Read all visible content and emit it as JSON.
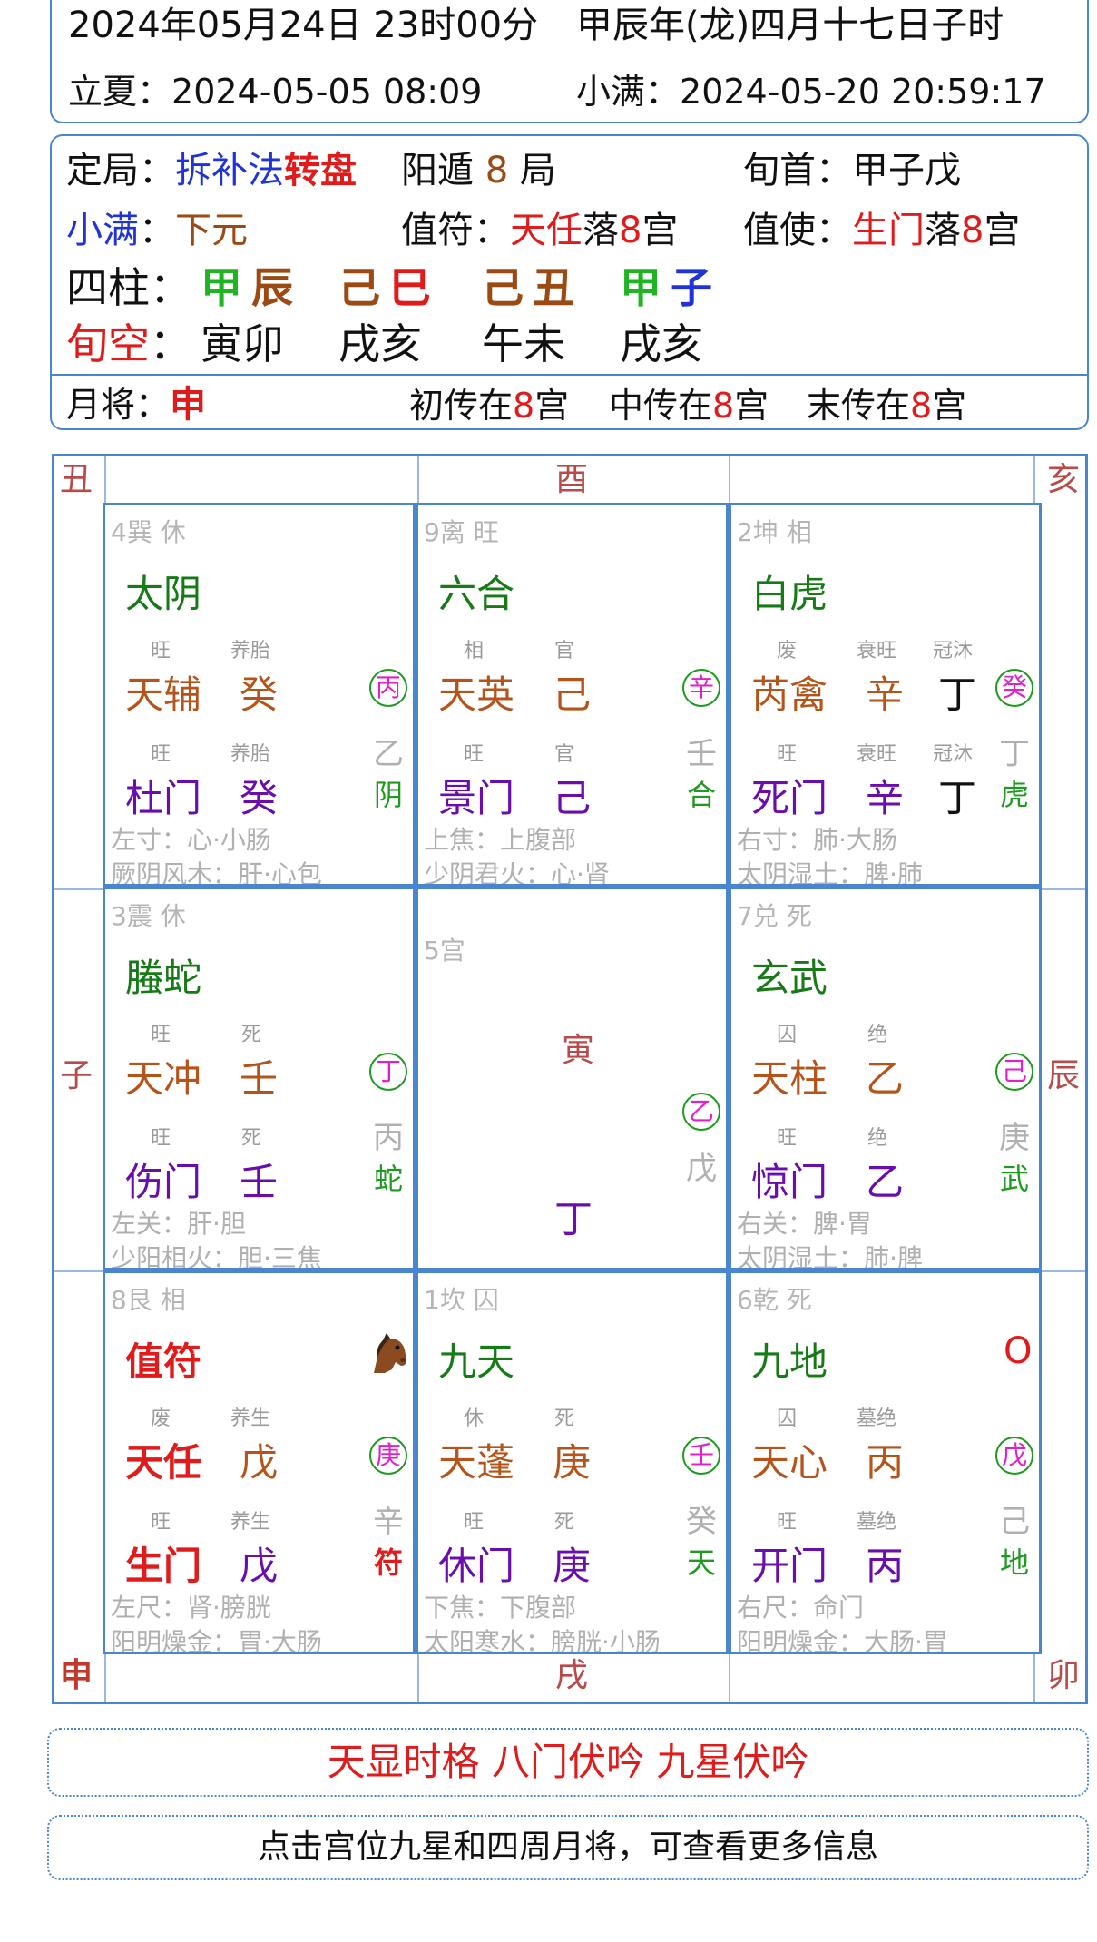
{
  "header": {
    "solar_datetime": "2024年05月24日 23时00分",
    "lunar_datetime": "甲辰年(龙)四月十七日子时",
    "term1_label": "立夏",
    "term1_value": "2024-05-05 08:09",
    "term2_label": "小满",
    "term2_value": "2024-05-20 20:59:17"
  },
  "info": {
    "dingju_label": "定局",
    "method_a": "拆补法",
    "method_b": "转盘",
    "dun": "阳遁",
    "ju_num": "8",
    "ju": "局",
    "xunshou_label": "旬首",
    "xunshou_value": "甲子戊",
    "term_label": "小满",
    "yuan": "下元",
    "zhifu_label": "值符",
    "zhifu_star": "天任",
    "zhifu_luo": "落",
    "zhifu_num": "8",
    "zhifu_gong": "宫",
    "zhishi_label": "值使",
    "zhishi_door": "生门",
    "zhishi_luo": "落",
    "zhishi_num": "8",
    "zhishi_gong": "宫",
    "sizhu_label": "四柱",
    "pillars": [
      {
        "stem": "甲",
        "branch": "辰"
      },
      {
        "stem": "己",
        "branch": "巳"
      },
      {
        "stem": "己",
        "branch": "丑"
      },
      {
        "stem": "甲",
        "branch": "子"
      }
    ],
    "xunkong_label": "旬空",
    "xunkong": [
      "寅卯",
      "戌亥",
      "午未",
      "戌亥"
    ],
    "yuejiang_label": "月将",
    "yuejiang_value": "申",
    "chu": {
      "pre": "初传在",
      "num": "8",
      "suf": "宫"
    },
    "zhong": {
      "pre": "中传在",
      "num": "8",
      "suf": "宫"
    },
    "mo": {
      "pre": "末传在",
      "num": "8",
      "suf": "宫"
    }
  },
  "board": {
    "corners": {
      "tl": "丑",
      "tc": "酉",
      "tr": "亥",
      "ml": "子",
      "mr": "辰",
      "bl": "申",
      "bc": "戌",
      "br": "卯"
    },
    "palaces": [
      {
        "head": "4巽  休",
        "god": "太阴",
        "star_lbl1": "旺",
        "star_lbl2": "养胎",
        "star": "天辅",
        "star_stem": "癸",
        "star_stem2": "",
        "circle": "丙",
        "gstem": "乙",
        "door_lbl1": "旺",
        "door_lbl2": "养胎",
        "door": "杜门",
        "door_stem": "癸",
        "door_stem2": "",
        "abbr": "阴",
        "foot1": "左寸：心·小肠",
        "foot2": "厥阴风木：肝·心包"
      },
      {
        "head": "9离  旺",
        "god": "六合",
        "star_lbl1": "相",
        "star_lbl2": "官",
        "star": "天英",
        "star_stem": "己",
        "star_stem2": "",
        "circle": "辛",
        "gstem": "壬",
        "door_lbl1": "旺",
        "door_lbl2": "官",
        "door": "景门",
        "door_stem": "己",
        "door_stem2": "",
        "abbr": "合",
        "foot1": "上焦：上腹部",
        "foot2": "少阴君火：心·肾"
      },
      {
        "head": "2坤  相",
        "god": "白虎",
        "star_lbl1": "废",
        "star_lbl2": "衰旺",
        "star_lbl3": "冠沐",
        "star": "芮禽",
        "star_stem": "辛",
        "star_stem2": "丁",
        "circle": "癸",
        "gstem": "丁",
        "door_lbl1": "旺",
        "door_lbl2": "衰旺",
        "door_lbl3": "冠沐",
        "door": "死门",
        "door_stem": "辛",
        "door_stem2": "丁",
        "abbr": "虎",
        "foot1": "右寸：肺·大肠",
        "foot2": "太阴湿土：脾·肺"
      },
      {
        "head": "3震  休",
        "god": "螣蛇",
        "star_lbl1": "旺",
        "star_lbl2": "死",
        "star": "天冲",
        "star_stem": "壬",
        "star_stem2": "",
        "circle": "丁",
        "gstem": "丙",
        "door_lbl1": "旺",
        "door_lbl2": "死",
        "door": "伤门",
        "door_stem": "壬",
        "door_stem2": "",
        "abbr": "蛇",
        "foot1": "左关：肝·胆",
        "foot2": "少阳相火：胆·三焦"
      },
      {
        "head": "5宫",
        "branch": "寅",
        "circle": "乙",
        "gstem": "戊",
        "stem": "丁"
      },
      {
        "head": "7兑  死",
        "god": "玄武",
        "star_lbl1": "囚",
        "star_lbl2": "绝",
        "star": "天柱",
        "star_stem": "乙",
        "star_stem2": "",
        "circle": "己",
        "gstem": "庚",
        "door_lbl1": "旺",
        "door_lbl2": "绝",
        "door": "惊门",
        "door_stem": "乙",
        "door_stem2": "",
        "abbr": "武",
        "foot1": "右关：脾·胃",
        "foot2": "太阴湿土：肺·脾"
      },
      {
        "head": "8艮  相",
        "god": "值符",
        "star_lbl1": "废",
        "star_lbl2": "养生",
        "star": "天任",
        "star_stem": "戊",
        "star_stem2": "",
        "circle": "庚",
        "gstem": "辛",
        "door_lbl1": "旺",
        "door_lbl2": "养生",
        "door": "生门",
        "door_stem": "戊",
        "door_stem2": "",
        "abbr": "符",
        "foot1": "左尺：肾·膀胱",
        "foot2": "阳明燥金：胃·大肠"
      },
      {
        "head": "1坎  囚",
        "god": "九天",
        "star_lbl1": "休",
        "star_lbl2": "死",
        "star": "天蓬",
        "star_stem": "庚",
        "star_stem2": "",
        "circle": "壬",
        "gstem": "癸",
        "door_lbl1": "旺",
        "door_lbl2": "死",
        "door": "休门",
        "door_stem": "庚",
        "door_stem2": "",
        "abbr": "天",
        "foot1": "下焦：下腹部",
        "foot2": "太阳寒水：膀胱·小肠"
      },
      {
        "head": "6乾  死",
        "god": "九地",
        "mark": "O",
        "star_lbl1": "囚",
        "star_lbl2": "墓绝",
        "star": "天心",
        "star_stem": "丙",
        "star_stem2": "",
        "circle": "戊",
        "gstem": "己",
        "door_lbl1": "旺",
        "door_lbl2": "墓绝",
        "door": "开门",
        "door_stem": "丙",
        "door_stem2": "",
        "abbr": "地",
        "foot1": "右尺：命门",
        "foot2": "阳明燥金：大肠·胃"
      }
    ]
  },
  "patterns": "天显时格 八门伏吟 九星伏吟",
  "hint": "点击宫位九星和四周月将，可查看更多信息",
  "colors": {
    "border": "#4a86d0",
    "red": "#e01b1b",
    "god_green": "#167a16",
    "star_orange": "#b5541a",
    "door_purple": "#6a0dad",
    "circle_text": "#e020c8"
  }
}
